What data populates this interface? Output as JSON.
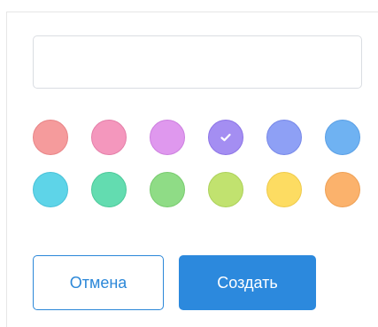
{
  "dialog": {
    "name_input": {
      "value": "",
      "placeholder": ""
    },
    "selected_index": 3,
    "colors": [
      {
        "name": "red",
        "fill": "#f59b9c",
        "border": "#e88486"
      },
      {
        "name": "pink",
        "fill": "#f497bd",
        "border": "#e47fa8"
      },
      {
        "name": "violet",
        "fill": "#df98ee",
        "border": "#cc7fdf"
      },
      {
        "name": "purple",
        "fill": "#a48ef2",
        "border": "#8c74e6"
      },
      {
        "name": "indigo",
        "fill": "#8ea0f5",
        "border": "#7788e8"
      },
      {
        "name": "blue",
        "fill": "#6fb2f2",
        "border": "#5a9fe5"
      },
      {
        "name": "cyan",
        "fill": "#5ed4e8",
        "border": "#48c1d8"
      },
      {
        "name": "teal",
        "fill": "#63dcb0",
        "border": "#4cc99a"
      },
      {
        "name": "green",
        "fill": "#8fdc86",
        "border": "#78cb6e"
      },
      {
        "name": "lime",
        "fill": "#c1e26f",
        "border": "#acd15a"
      },
      {
        "name": "yellow",
        "fill": "#fddc62",
        "border": "#efca4a"
      },
      {
        "name": "orange",
        "fill": "#fbb26c",
        "border": "#eea055"
      }
    ],
    "check_icon": "check-icon",
    "cancel_label": "Отмена",
    "create_label": "Создать"
  }
}
